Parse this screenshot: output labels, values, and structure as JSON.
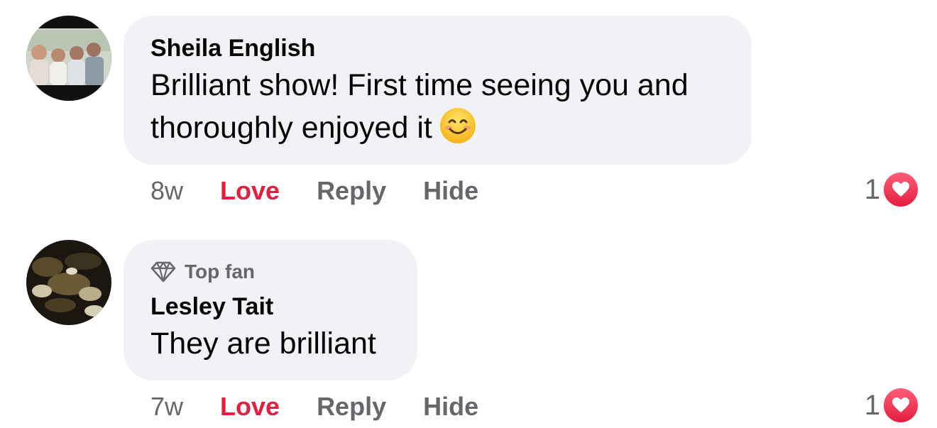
{
  "comments": [
    {
      "author": "Sheila English",
      "text_line1": "Brilliant show! First time seeing you and",
      "text_line2": "thoroughly enjoyed it",
      "emoji": "smiling-face-icon",
      "time": "8w",
      "love_label": "Love",
      "reply_label": "Reply",
      "hide_label": "Hide",
      "reaction_count": "1"
    },
    {
      "badge": "Top fan",
      "author": "Lesley Tait",
      "text": "They are brilliant",
      "time": "7w",
      "love_label": "Love",
      "reply_label": "Reply",
      "hide_label": "Hide",
      "reaction_count": "1"
    }
  ],
  "colors": {
    "bubble": "#f0f2f5",
    "love": "#e41e3f",
    "secondary_text": "#65676b",
    "primary_text": "#050505"
  }
}
